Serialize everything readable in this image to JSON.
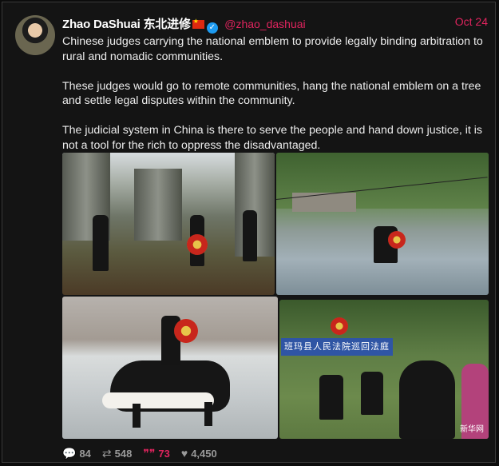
{
  "post": {
    "author_name": "Zhao DaShuai 东北进修",
    "handle": "@zhao_dashuai",
    "date": "Oct 24",
    "paragraphs": [
      "Chinese judges carrying the national emblem to provide legally binding arbitration to rural and nomadic communities.",
      "These judges would go to remote communities, hang the national emblem on a tree and settle legal disputes within the community.",
      "The judicial system in China is there to serve the people and hand down justice, it is not a tool for the rich to oppress the disadvantaged."
    ],
    "icons": {
      "flag": "china-flag-icon",
      "verified": "verified-badge-icon"
    }
  },
  "media": {
    "photo4_banner": "班玛县人民法院巡回法庭",
    "photo4_watermark": "新华网"
  },
  "actions": {
    "replies": "84",
    "reposts": "548",
    "quotes": "73",
    "likes": "4,450"
  },
  "colors": {
    "accent": "#e0245e",
    "verified": "#1d9bf0",
    "background": "#141414"
  }
}
